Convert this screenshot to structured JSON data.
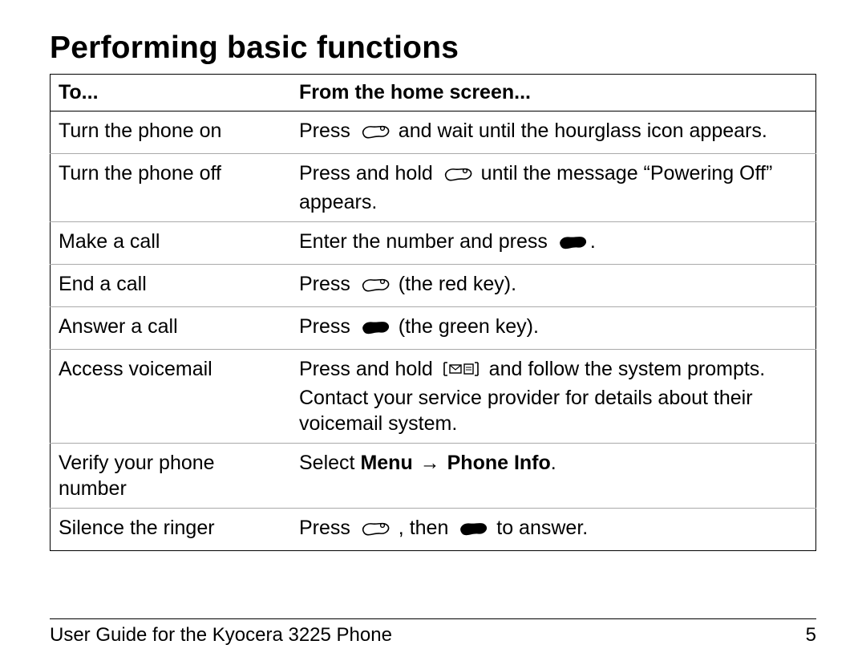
{
  "title": "Performing basic functions",
  "table": {
    "header": {
      "to": "To...",
      "from": "From the home screen..."
    },
    "rows": [
      {
        "to": "Turn the phone on",
        "from_parts": [
          {
            "t": "Press "
          },
          {
            "icon": "end-key-icon"
          },
          {
            "t": " and wait until the hourglass icon appears."
          }
        ]
      },
      {
        "to": "Turn the phone off",
        "from_parts": [
          {
            "t": "Press and hold "
          },
          {
            "icon": "end-key-icon"
          },
          {
            "t": " until the message “Powering Off” appears."
          }
        ]
      },
      {
        "to": "Make a call",
        "from_parts": [
          {
            "t": "Enter the number and press "
          },
          {
            "icon": "send-key-solid-icon"
          },
          {
            "t": "."
          }
        ]
      },
      {
        "to": "End a call",
        "from_parts": [
          {
            "t": "Press "
          },
          {
            "icon": "end-key-icon"
          },
          {
            "t": " (the red key)."
          }
        ]
      },
      {
        "to": "Answer a call",
        "from_parts": [
          {
            "t": "Press "
          },
          {
            "icon": "send-key-solid-icon"
          },
          {
            "t": " (the green key)."
          }
        ]
      },
      {
        "to": "Access voicemail",
        "from_parts": [
          {
            "t": "Press and hold "
          },
          {
            "icon": "voicemail-key-icon"
          },
          {
            "t": " and follow the system prompts. Contact your service provider for details about their voicemail system."
          }
        ]
      },
      {
        "to": "Verify your phone number",
        "from_parts": [
          {
            "t": "Select "
          },
          {
            "t": "Menu",
            "b": true
          },
          {
            "t": " "
          },
          {
            "arrow": true,
            "b": true
          },
          {
            "t": " "
          },
          {
            "t": "Phone Info",
            "b": true
          },
          {
            "t": "."
          }
        ]
      },
      {
        "to": "Silence the ringer",
        "from_parts": [
          {
            "t": " Press "
          },
          {
            "icon": "end-key-icon"
          },
          {
            "t": " , then "
          },
          {
            "icon": "send-key-solid-icon"
          },
          {
            "t": " to answer."
          }
        ]
      }
    ]
  },
  "footer": {
    "left": "User Guide for the Kyocera 3225 Phone",
    "right": "5"
  },
  "icons": {
    "arrow_glyph": "→"
  }
}
